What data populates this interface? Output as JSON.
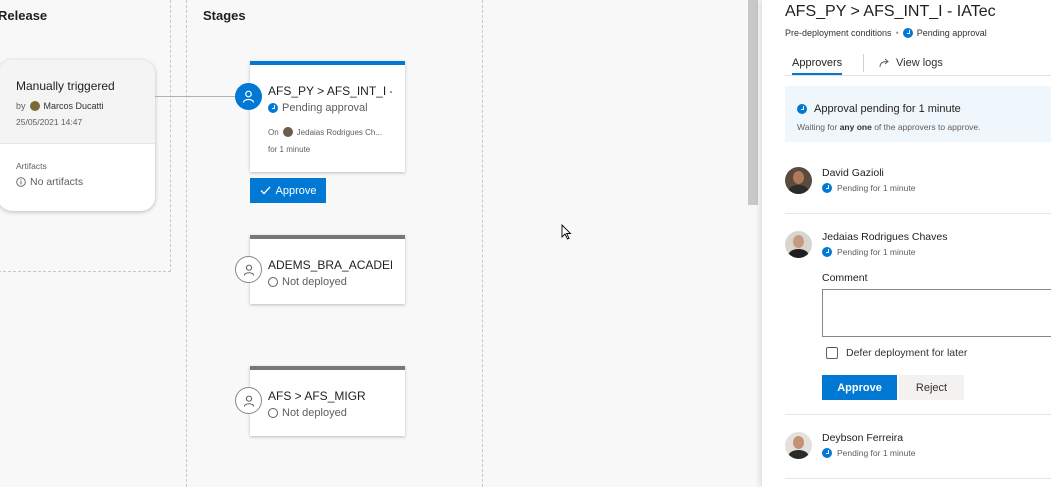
{
  "columns": {
    "release": "Release",
    "stages": "Stages"
  },
  "release_card": {
    "title": "Manually triggered",
    "by_prefix": "by",
    "author": "Marcos Ducatti",
    "date": "25/05/2021 14:47",
    "artifacts_label": "Artifacts",
    "artifacts_value": "No artifacts"
  },
  "stages": [
    {
      "title": "AFS_PY > AFS_INT_I -",
      "status": "Pending approval",
      "on_prefix": "On",
      "on_user": "Jedaias Rodrigues Ch...",
      "duration": "for 1 minute",
      "action_label": "Approve"
    },
    {
      "title": "ADEMS_BRA_ACADEM",
      "status": "Not deployed"
    },
    {
      "title": "AFS > AFS_MIGR",
      "status": "Not deployed"
    }
  ],
  "panel": {
    "title": "AFS_PY > AFS_INT_I - IATec",
    "subtitle": "Pre-deployment conditions",
    "subtitle_dot": "•",
    "subtitle_status": "Pending approval",
    "tabs": {
      "approvers": "Approvers",
      "view_logs": "View logs"
    },
    "info": {
      "title": "Approval pending for 1 minute",
      "desc_prefix": "Waiting for",
      "desc_bold": "any one",
      "desc_suffix": "of the approvers to approve."
    },
    "approvers": [
      {
        "name": "David Gazioli",
        "status": "Pending for 1 minute"
      },
      {
        "name": "Jedaias Rodrigues Chaves",
        "status": "Pending for 1 minute"
      },
      {
        "name": "Deybson Ferreira",
        "status": "Pending for 1 minute"
      }
    ],
    "comment_label": "Comment",
    "comment_value": "",
    "defer_label": "Defer deployment for later",
    "approve_label": "Approve",
    "reject_label": "Reject"
  },
  "colors": {
    "accent": "#0078d4",
    "pending_bg": "#eff6fc"
  },
  "icons": [
    "user-icon",
    "clock-icon",
    "info-icon",
    "not-deployed-icon",
    "checkmark-icon",
    "view-logs-icon",
    "mouse-cursor-icon"
  ]
}
